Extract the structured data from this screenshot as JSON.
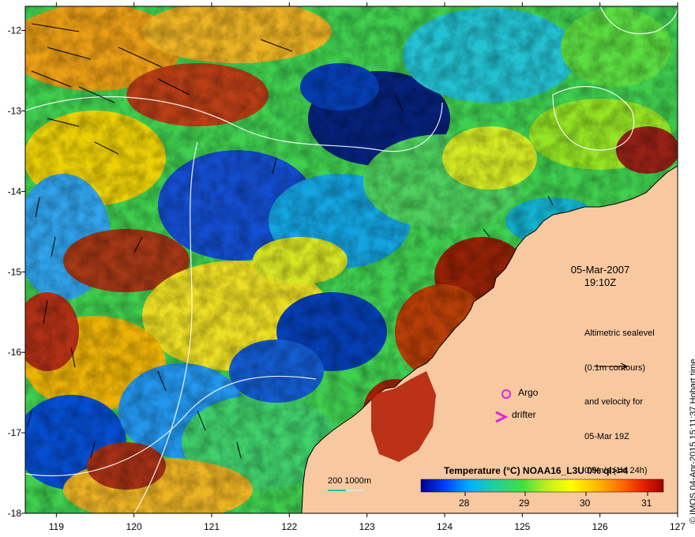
{
  "map": {
    "lon_ticks": [
      "119",
      "120",
      "121",
      "122",
      "123",
      "124",
      "125",
      "126",
      "127"
    ],
    "lat_ticks": [
      "-12",
      "-13",
      "-14",
      "-15",
      "-16",
      "-17",
      "-18"
    ],
    "lon_range": [
      118.6,
      127.0
    ],
    "lat_range": [
      -18.0,
      -11.7
    ],
    "colors": {
      "land": "#f8c8a0",
      "coast": "#000000",
      "contour": "#ffffff",
      "argo": "#e020e0",
      "drifter": "#e020e0"
    }
  },
  "labels": {
    "date": "05-Mar-2007",
    "time": "19:10Z",
    "altimetry_lines": [
      "Altimetric sealevel",
      "(0.1m contours)",
      "and velocity for",
      "05-Mar 19Z",
      "0.5m/s (1kt 24h)"
    ],
    "argo": "Argo",
    "drifter": "drifter",
    "scale": "200  1000m",
    "credit": "© IMOS 04-Apr-2015 15:11:37 Hobart time"
  },
  "legend": {
    "title": "Temperature (°C) NOAA16_L3U 0% ql>=4",
    "ticks": [
      "28",
      "29",
      "30",
      "31"
    ],
    "colors": [
      "#000090",
      "#0040ff",
      "#00b0ff",
      "#20d0a0",
      "#40e040",
      "#c0f020",
      "#ffff00",
      "#ffb000",
      "#ff6000",
      "#e02000",
      "#a00000"
    ]
  }
}
